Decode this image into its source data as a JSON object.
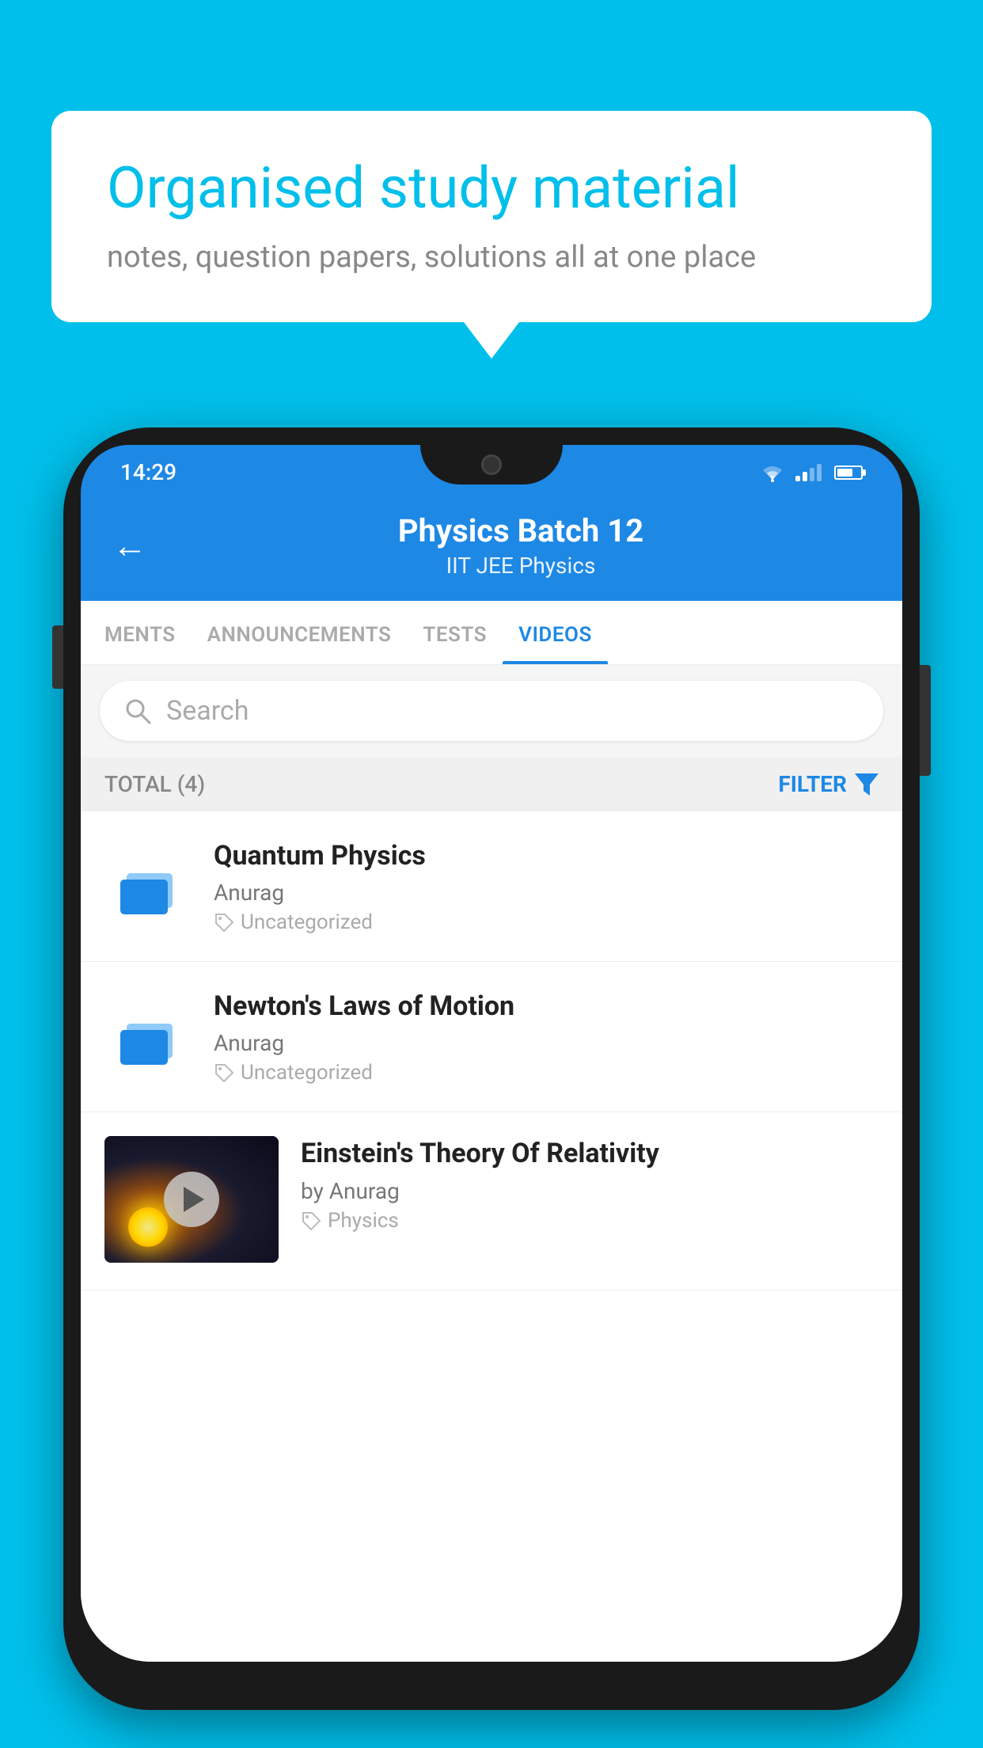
{
  "background_color": "#00BFEA",
  "speech_bubble": {
    "title": "Organised study material",
    "subtitle": "notes, question papers, solutions all at one place"
  },
  "phone": {
    "status_bar": {
      "time": "14:29"
    },
    "header": {
      "back_label": "←",
      "title": "Physics Batch 12",
      "subtitle_tags": "IIT JEE   Physics"
    },
    "tabs": [
      {
        "label": "MENTS",
        "active": false
      },
      {
        "label": "ANNOUNCEMENTS",
        "active": false
      },
      {
        "label": "TESTS",
        "active": false
      },
      {
        "label": "VIDEOS",
        "active": true
      }
    ],
    "search": {
      "placeholder": "Search"
    },
    "filter_bar": {
      "total_label": "TOTAL (4)",
      "filter_label": "FILTER"
    },
    "videos": [
      {
        "id": "quantum",
        "title": "Quantum Physics",
        "author": "Anurag",
        "tag": "Uncategorized",
        "type": "folder"
      },
      {
        "id": "newton",
        "title": "Newton's Laws of Motion",
        "author": "Anurag",
        "tag": "Uncategorized",
        "type": "folder"
      },
      {
        "id": "einstein",
        "title": "Einstein's Theory Of Relativity",
        "author": "by Anurag",
        "tag": "Physics",
        "type": "video"
      }
    ]
  }
}
